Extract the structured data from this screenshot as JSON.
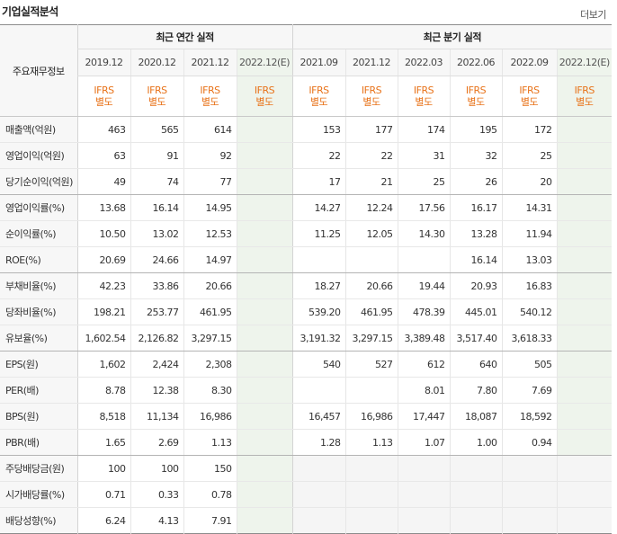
{
  "section": {
    "title": "기업실적분석",
    "more_label": "더보기"
  },
  "header": {
    "row_label": "주요재무정보",
    "annual_group": "최근 연간 실적",
    "quarter_group": "최근 분기 실적",
    "annual_periods": [
      "2019.12",
      "2020.12",
      "2021.12",
      "2022.12(E)"
    ],
    "quarter_periods": [
      "2021.09",
      "2021.12",
      "2022.03",
      "2022.06",
      "2022.09",
      "2022.12(E)"
    ],
    "ifrs_line1": "IFRS",
    "ifrs_line2": "별도"
  },
  "rows": [
    {
      "label": "매출액(억원)",
      "annual": [
        "463",
        "565",
        "614",
        ""
      ],
      "quarter": [
        "153",
        "177",
        "174",
        "195",
        "172",
        ""
      ]
    },
    {
      "label": "영업이익(억원)",
      "annual": [
        "63",
        "91",
        "92",
        ""
      ],
      "quarter": [
        "22",
        "22",
        "31",
        "32",
        "25",
        ""
      ]
    },
    {
      "label": "당기순이익(억원)",
      "annual": [
        "49",
        "74",
        "77",
        ""
      ],
      "quarter": [
        "17",
        "21",
        "25",
        "26",
        "20",
        ""
      ]
    },
    {
      "label": "영업이익률(%)",
      "annual": [
        "13.68",
        "16.14",
        "14.95",
        ""
      ],
      "quarter": [
        "14.27",
        "12.24",
        "17.56",
        "16.17",
        "14.31",
        ""
      ]
    },
    {
      "label": "순이익률(%)",
      "annual": [
        "10.50",
        "13.02",
        "12.53",
        ""
      ],
      "quarter": [
        "11.25",
        "12.05",
        "14.30",
        "13.28",
        "11.94",
        ""
      ]
    },
    {
      "label": "ROE(%)",
      "annual": [
        "20.69",
        "24.66",
        "14.97",
        ""
      ],
      "quarter": [
        "",
        "",
        "",
        "16.14",
        "13.03",
        ""
      ]
    },
    {
      "label": "부채비율(%)",
      "annual": [
        "42.23",
        "33.86",
        "20.66",
        ""
      ],
      "quarter": [
        "18.27",
        "20.66",
        "19.44",
        "20.93",
        "16.83",
        ""
      ]
    },
    {
      "label": "당좌비율(%)",
      "annual": [
        "198.21",
        "253.77",
        "461.95",
        ""
      ],
      "quarter": [
        "539.20",
        "461.95",
        "478.39",
        "445.01",
        "540.12",
        ""
      ]
    },
    {
      "label": "유보율(%)",
      "annual": [
        "1,602.54",
        "2,126.82",
        "3,297.15",
        ""
      ],
      "quarter": [
        "3,191.32",
        "3,297.15",
        "3,389.48",
        "3,517.40",
        "3,618.33",
        ""
      ]
    },
    {
      "label": "EPS(원)",
      "annual": [
        "1,602",
        "2,424",
        "2,308",
        ""
      ],
      "quarter": [
        "540",
        "527",
        "612",
        "640",
        "505",
        ""
      ]
    },
    {
      "label": "PER(배)",
      "annual": [
        "8.78",
        "12.38",
        "8.30",
        ""
      ],
      "quarter": [
        "",
        "",
        "8.01",
        "7.80",
        "7.69",
        ""
      ]
    },
    {
      "label": "BPS(원)",
      "annual": [
        "8,518",
        "11,134",
        "16,986",
        ""
      ],
      "quarter": [
        "16,457",
        "16,986",
        "17,447",
        "18,087",
        "18,592",
        ""
      ]
    },
    {
      "label": "PBR(배)",
      "annual": [
        "1.65",
        "2.69",
        "1.13",
        ""
      ],
      "quarter": [
        "1.28",
        "1.13",
        "1.07",
        "1.00",
        "0.94",
        ""
      ]
    },
    {
      "label": "주당배당금(원)",
      "annual": [
        "100",
        "100",
        "150",
        ""
      ],
      "quarter": [
        "",
        "",
        "",
        "",
        "",
        ""
      ]
    },
    {
      "label": "시가배당률(%)",
      "annual": [
        "0.71",
        "0.33",
        "0.78",
        ""
      ],
      "quarter": [
        "",
        "",
        "",
        "",
        "",
        ""
      ]
    },
    {
      "label": "배당성향(%)",
      "annual": [
        "6.24",
        "4.13",
        "7.91",
        ""
      ],
      "quarter": [
        "",
        "",
        "",
        "",
        "",
        ""
      ]
    }
  ],
  "colors": {
    "ifrs_text": "#e8731a",
    "estimate_bg": "#eef4ec",
    "header_bg": "#f7f7f7"
  }
}
